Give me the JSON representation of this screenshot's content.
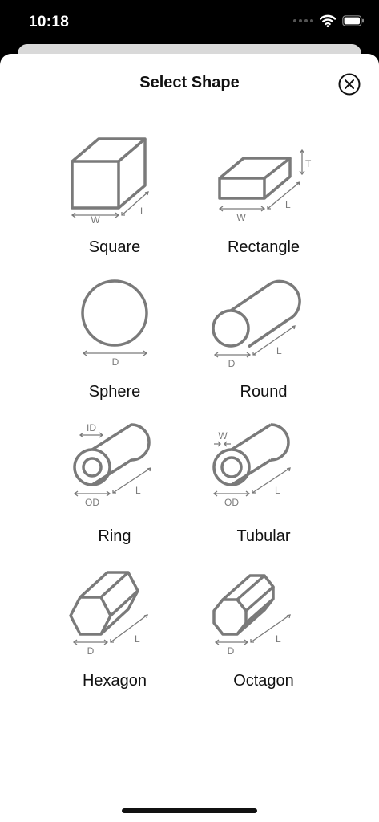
{
  "status_bar": {
    "time": "10:18"
  },
  "sheet": {
    "title": "Select Shape"
  },
  "shapes": [
    {
      "id": "square",
      "label": "Square",
      "dims": [
        "W",
        "L"
      ]
    },
    {
      "id": "rectangle",
      "label": "Rectangle",
      "dims": [
        "W",
        "L",
        "T"
      ]
    },
    {
      "id": "sphere",
      "label": "Sphere",
      "dims": [
        "D"
      ]
    },
    {
      "id": "round",
      "label": "Round",
      "dims": [
        "D",
        "L"
      ]
    },
    {
      "id": "ring",
      "label": "Ring",
      "dims": [
        "ID",
        "OD",
        "L"
      ]
    },
    {
      "id": "tubular",
      "label": "Tubular",
      "dims": [
        "W",
        "OD",
        "L"
      ]
    },
    {
      "id": "hexagon",
      "label": "Hexagon",
      "dims": [
        "D",
        "L"
      ]
    },
    {
      "id": "octagon",
      "label": "Octagon",
      "dims": [
        "D",
        "L"
      ]
    }
  ],
  "colors": {
    "icon_stroke": "#7a7a7a",
    "text": "#111111"
  }
}
